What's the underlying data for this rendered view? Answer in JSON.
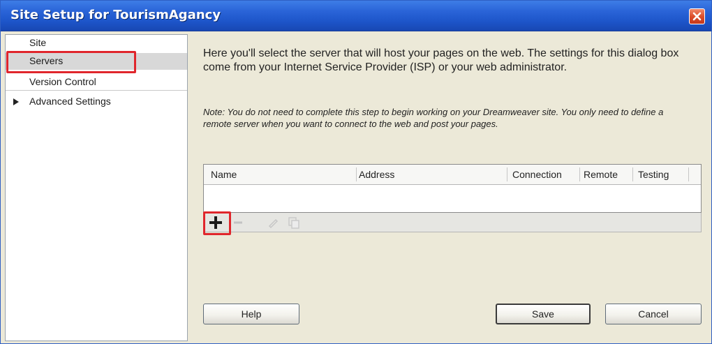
{
  "window": {
    "title": "Site Setup for TourismAgancy"
  },
  "sidebar": {
    "items": [
      {
        "label": "Site"
      },
      {
        "label": "Servers"
      },
      {
        "label": "Version Control"
      },
      {
        "label": "Advanced Settings"
      }
    ],
    "selected": "Servers"
  },
  "main": {
    "intro": "Here you'll select the server that will host your pages on the web. The settings for this dialog box come from your Internet Service Provider (ISP) or your web administrator.",
    "note": "Note: You do not need to complete this step to begin working on your Dreamweaver site. You only need to define a remote server when you want to connect to the web and post your pages.",
    "table": {
      "columns": [
        "Name",
        "Address",
        "Connection",
        "Remote",
        "Testing"
      ],
      "rows": []
    },
    "toolbar": {
      "icons": [
        "plus-icon",
        "minus-icon",
        "pencil-icon",
        "duplicate-icon"
      ]
    }
  },
  "buttons": {
    "help": "Help",
    "save": "Save",
    "cancel": "Cancel"
  },
  "colors": {
    "title_bar": "#2a64d8",
    "highlight": "#e0262c",
    "dialog_bg": "#ece9d8",
    "selected_item": "#d8d8d8"
  }
}
